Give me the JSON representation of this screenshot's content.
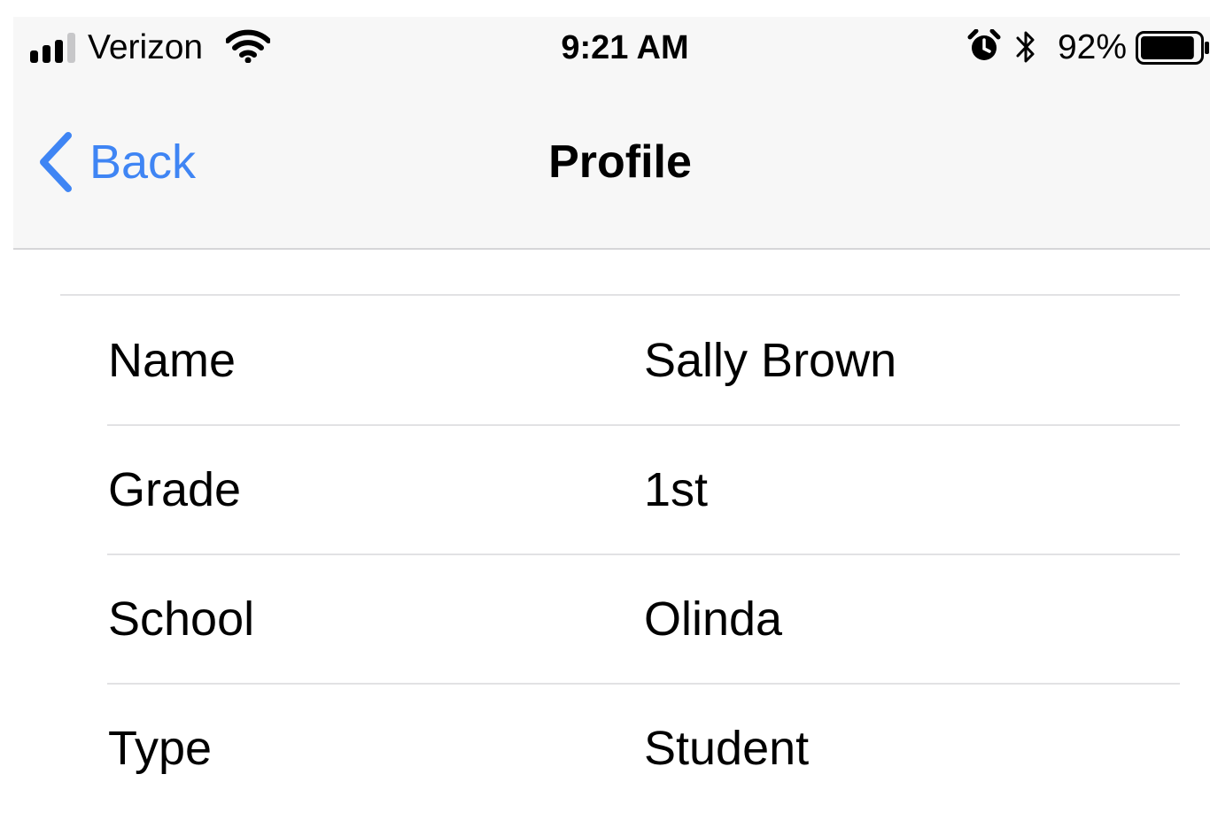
{
  "status_bar": {
    "carrier": "Verizon",
    "time": "9:21 AM",
    "battery_percent": "92%",
    "battery_level": 0.92,
    "icons": [
      "signal-icon",
      "wifi-icon",
      "alarm-icon",
      "bluetooth-icon",
      "battery-icon"
    ]
  },
  "nav_bar": {
    "back_label": "Back",
    "title": "Profile",
    "back_icon": "chevron-left-icon"
  },
  "profile_rows": [
    {
      "label": "Name",
      "value": "Sally Brown"
    },
    {
      "label": "Grade",
      "value": "1st"
    },
    {
      "label": "School",
      "value": "Olinda"
    },
    {
      "label": "Type",
      "value": "Student"
    }
  ],
  "colors": {
    "accent": "#3f85f4",
    "nav_background": "#f7f7f7",
    "separator": "#e2e2e4",
    "text": "#000000"
  }
}
